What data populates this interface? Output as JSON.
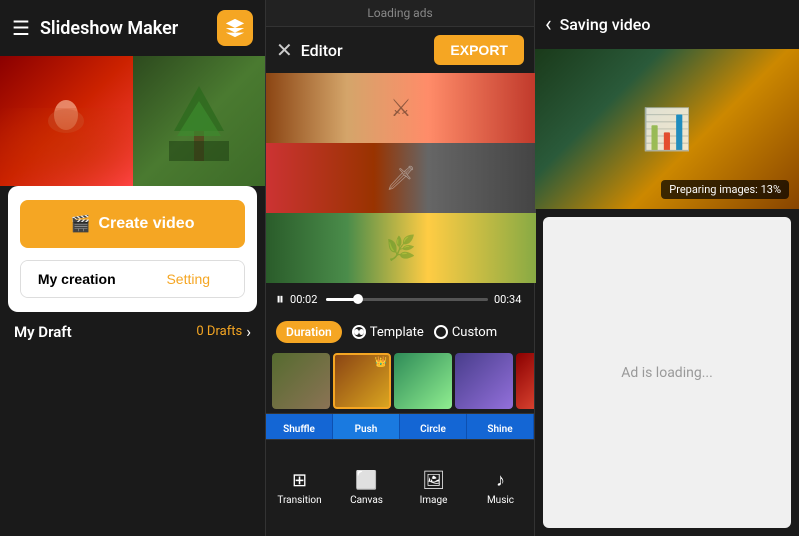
{
  "app": {
    "title": "Slideshow Maker"
  },
  "left": {
    "create_video_label": "Create video",
    "my_creation_label": "My creation",
    "setting_label": "Setting",
    "my_draft_label": "My Draft",
    "drafts_count": "0 Drafts"
  },
  "middle": {
    "loading_ads_label": "Loading ads",
    "editor_title": "Editor",
    "export_label": "EXPORT",
    "time_current": "00:02",
    "time_total": "00:34",
    "duration_label": "Duration",
    "template_label": "Template",
    "custom_label": "Custom",
    "transitions": [
      "Shuffle",
      "Push",
      "Circle",
      "Shine"
    ],
    "tools": [
      {
        "label": "Transition",
        "icon": "⊞"
      },
      {
        "label": "Canvas",
        "icon": "⬜"
      },
      {
        "label": "Image",
        "icon": "🖼"
      },
      {
        "label": "Music",
        "icon": "♪"
      }
    ]
  },
  "right": {
    "saving_title": "Saving video",
    "preparing_text": "Preparing images: 13%",
    "ad_loading_text": "Ad is loading..."
  },
  "icons": {
    "hamburger": "☰",
    "logo": "◆",
    "film": "🎬",
    "close": "✕",
    "back_arrow": "‹",
    "play_pause": "⏸",
    "chevron_right": "›"
  }
}
